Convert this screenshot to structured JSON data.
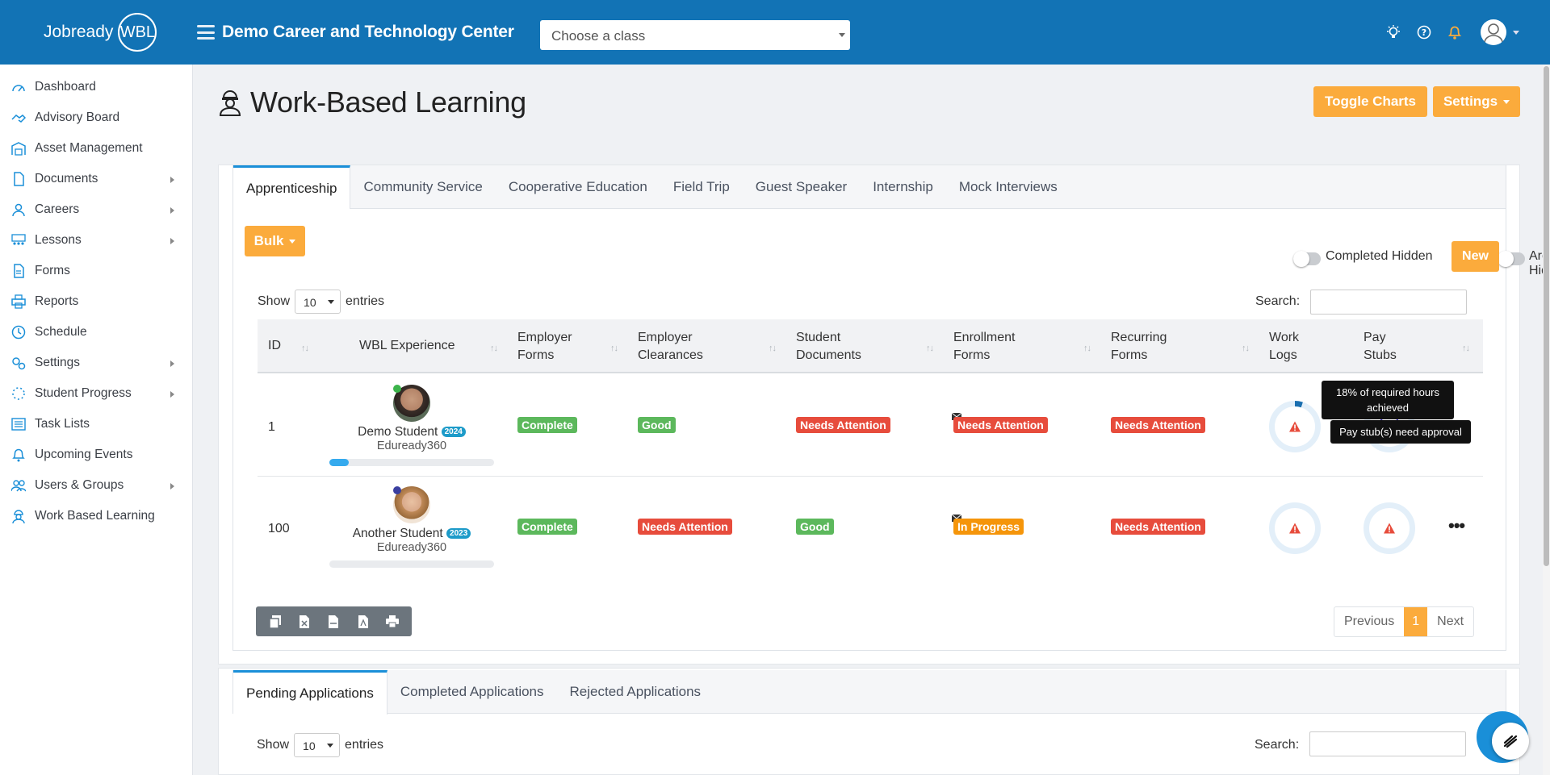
{
  "header": {
    "logo_text": "Jobready",
    "logo_badge": "WBL",
    "org_name": "Demo Career and Technology Center",
    "class_placeholder": "Choose a class"
  },
  "sidebar": {
    "items": [
      {
        "label": "Dashboard",
        "icon": "gauge-icon",
        "sub": false
      },
      {
        "label": "Advisory Board",
        "icon": "handshake-icon",
        "sub": false
      },
      {
        "label": "Asset Management",
        "icon": "warehouse-icon",
        "sub": false
      },
      {
        "label": "Documents",
        "icon": "document-icon",
        "sub": true
      },
      {
        "label": "Careers",
        "icon": "people-icon",
        "sub": true
      },
      {
        "label": "Lessons",
        "icon": "classroom-icon",
        "sub": true
      },
      {
        "label": "Forms",
        "icon": "form-icon",
        "sub": false
      },
      {
        "label": "Reports",
        "icon": "printer-icon",
        "sub": false
      },
      {
        "label": "Schedule",
        "icon": "clock-icon",
        "sub": false
      },
      {
        "label": "Settings",
        "icon": "gears-icon",
        "sub": true
      },
      {
        "label": "Student Progress",
        "icon": "spinner-icon",
        "sub": true
      },
      {
        "label": "Task Lists",
        "icon": "list-icon",
        "sub": false
      },
      {
        "label": "Upcoming Events",
        "icon": "bell-icon",
        "sub": false
      },
      {
        "label": "Users & Groups",
        "icon": "users-icon",
        "sub": true
      },
      {
        "label": "Work Based Learning",
        "icon": "worker-icon",
        "sub": false
      }
    ]
  },
  "page": {
    "title": "Work-Based Learning",
    "toggle_charts": "Toggle Charts",
    "settings": "Settings"
  },
  "tabs": [
    "Apprenticeship",
    "Community Service",
    "Cooperative Education",
    "Field Trip",
    "Guest Speaker",
    "Internship",
    "Mock Interviews"
  ],
  "controls": {
    "bulk": "Bulk",
    "completed_hidden": "Completed Hidden",
    "archived_hidden": "Archived Hidden",
    "new": "New",
    "show": "Show",
    "entries": "entries",
    "page_length": "10",
    "search": "Search:"
  },
  "table": {
    "columns": [
      "ID",
      "WBL Experience",
      "Employer Forms",
      "Employer Clearances",
      "Student Documents",
      "Enrollment Forms",
      "Recurring Forms",
      "Work Logs",
      "Pay Stubs"
    ],
    "rows": [
      {
        "id": "1",
        "name": "Demo Student",
        "year": "2024",
        "org": "Eduready360",
        "presence": "#3cb44b",
        "progress": 0.12,
        "employer_forms": "Complete",
        "employer_clearances": "Good",
        "student_documents": "Needs Attention",
        "enrollment_forms": "Needs Attention",
        "recurring_forms": "Needs Attention"
      },
      {
        "id": "100",
        "name": "Another Student",
        "year": "2023",
        "org": "Eduready360",
        "presence": "#3a3fa0",
        "progress": 0,
        "employer_forms": "Complete",
        "employer_clearances": "Needs Attention",
        "student_documents": "Good",
        "enrollment_forms": "In Progress",
        "recurring_forms": "Needs Attention"
      }
    ]
  },
  "tooltips": {
    "work_logs": "18% of required hours achieved",
    "pay_stubs": "Pay stub(s) need approval"
  },
  "pager": {
    "previous": "Previous",
    "current": "1",
    "next": "Next"
  },
  "applications": {
    "tabs": [
      "Pending Applications",
      "Completed Applications",
      "Rejected Applications"
    ],
    "show": "Show",
    "entries": "entries",
    "page_length": "10",
    "search": "Search:"
  },
  "colors": {
    "brand": "#1273b5",
    "accent": "#fbab3c",
    "success": "#5cb85c",
    "danger": "#e74c3c",
    "warning": "#f5950a"
  }
}
